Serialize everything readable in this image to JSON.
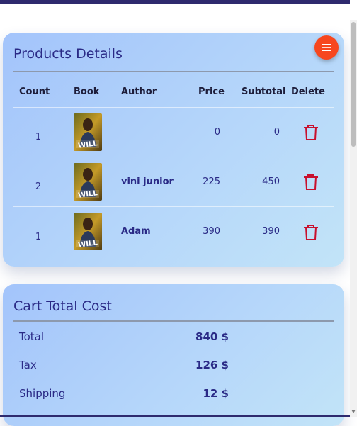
{
  "products": {
    "title": "Products Details",
    "menu_icon": "menu-icon",
    "columns": [
      "Count",
      "Book",
      "Author",
      "Price",
      "Subtotal",
      "Delete"
    ],
    "rows": [
      {
        "count": "1",
        "author": "",
        "price": "0",
        "subtotal": "0",
        "cover_text": "WILL"
      },
      {
        "count": "2",
        "author": "vini junior",
        "price": "225",
        "subtotal": "450",
        "cover_text": "WILL"
      },
      {
        "count": "1",
        "author": "Adam",
        "price": "390",
        "subtotal": "390",
        "cover_text": "WILL"
      }
    ]
  },
  "cart": {
    "title": "Cart Total Cost",
    "items": [
      {
        "label": "Total",
        "value": "840 $"
      },
      {
        "label": "Tax",
        "value": "126 $"
      },
      {
        "label": "Shipping",
        "value": "12 $"
      }
    ]
  },
  "colors": {
    "accent": "#f7471e",
    "title": "#2a2a86",
    "delete": "#c8102e",
    "topbar": "#2e2a6e"
  }
}
